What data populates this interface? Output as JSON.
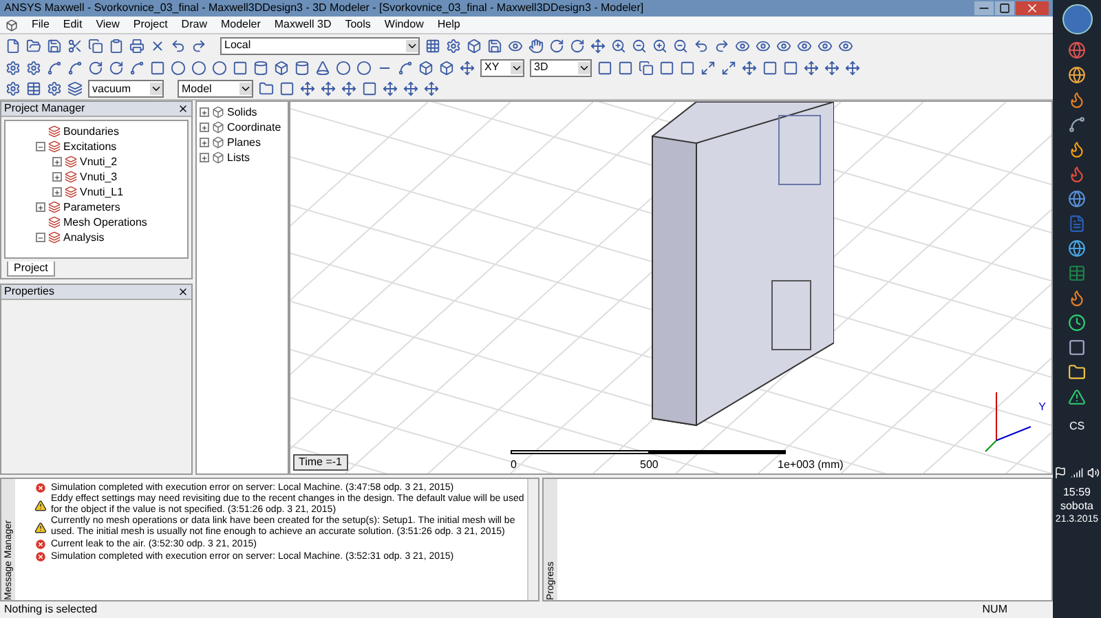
{
  "window": {
    "title": "ANSYS Maxwell - Svorkovnice_03_final - Maxwell3DDesign3 - 3D Modeler - [Svorkovnice_03_final - Maxwell3DDesign3 - Modeler]"
  },
  "menu": [
    "File",
    "Edit",
    "View",
    "Project",
    "Draw",
    "Modeler",
    "Maxwell 3D",
    "Tools",
    "Window",
    "Help"
  ],
  "toolbar": {
    "coordinate_system": "Local",
    "plane": "XY",
    "view_mode": "3D",
    "material": "vacuum",
    "model_type": "Model"
  },
  "project_manager": {
    "title": "Project Manager",
    "tab": "Project",
    "tree": [
      {
        "label": "Boundaries"
      },
      {
        "label": "Excitations",
        "expanded": true,
        "children": [
          {
            "label": "Vnuti_2",
            "expanded": false
          },
          {
            "label": "Vnuti_3",
            "expanded": false
          },
          {
            "label": "Vnuti_L1",
            "expanded": false
          }
        ]
      },
      {
        "label": "Parameters",
        "expanded": false
      },
      {
        "label": "Mesh Operations"
      },
      {
        "label": "Analysis",
        "expanded": true
      }
    ]
  },
  "properties": {
    "title": "Properties"
  },
  "model_tree": [
    {
      "label": "Solids"
    },
    {
      "label": "Coordinate"
    },
    {
      "label": "Planes"
    },
    {
      "label": "Lists"
    }
  ],
  "viewport": {
    "time_label": "Time =-1",
    "scale_labels": [
      "0",
      "500",
      "1e+003 (mm)"
    ],
    "axis_label": "Y"
  },
  "message_manager": {
    "title": "Message Manager",
    "messages": [
      {
        "kind": "error",
        "text": "Simulation completed with execution error on server: Local Machine. (3:47:58 odp.  3 21, 2015)"
      },
      {
        "kind": "warning",
        "text": "Eddy effect settings may need revisiting due to the recent changes in the design.  The default value will be used for the object if the value is not specified.  (3:51:26 odp.  3 21, 2015)"
      },
      {
        "kind": "warning",
        "text": "Currently no mesh operations or data link have been created for the setup(s): Setup1.  The initial mesh will be used.  The initial mesh is usually not fine enough to achieve an accurate solution. (3:51:26 odp.  3 21, 2015)"
      },
      {
        "kind": "error",
        "text": "Current leak to the air. (3:52:30 odp.  3 21, 2015)"
      },
      {
        "kind": "error",
        "text": "Simulation completed with execution error on server: Local Machine. (3:52:31 odp.  3 21, 2015)"
      }
    ]
  },
  "progress": {
    "title": "Progress"
  },
  "status_bar": {
    "text": "Nothing is selected",
    "num": "NUM"
  },
  "taskbar": {
    "language": "CS",
    "time": "15:59",
    "day": "sobota",
    "date": "21.3.2015"
  }
}
